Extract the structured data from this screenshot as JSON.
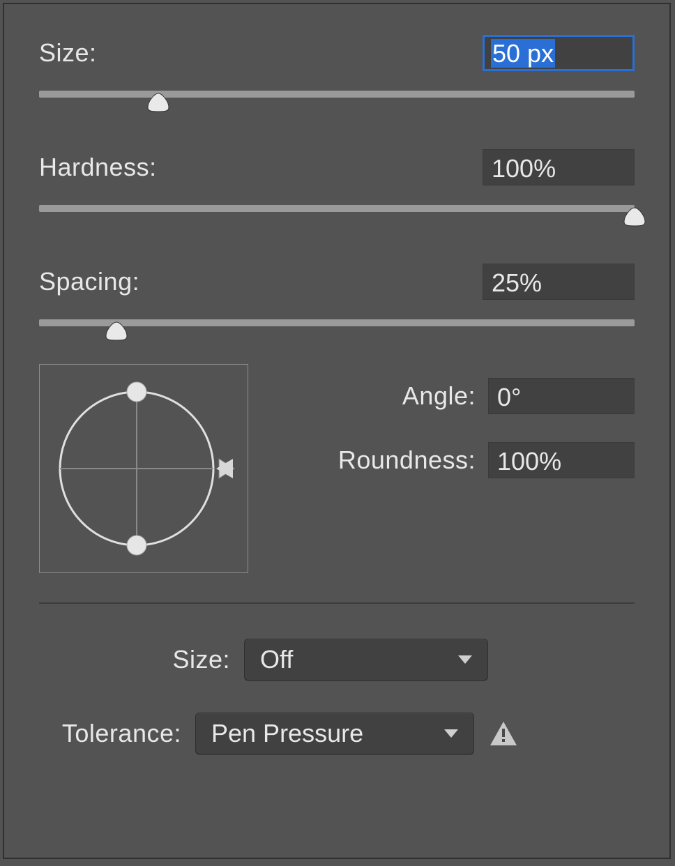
{
  "size": {
    "label": "Size:",
    "value": "50 px",
    "slider_pct": 20
  },
  "hardness": {
    "label": "Hardness:",
    "value": "100%",
    "slider_pct": 100
  },
  "spacing": {
    "label": "Spacing:",
    "value": "25%",
    "slider_pct": 13
  },
  "angle": {
    "label": "Angle:",
    "value": "0°"
  },
  "roundness": {
    "label": "Roundness:",
    "value": "100%"
  },
  "dyn_size": {
    "label": "Size:",
    "value": "Off"
  },
  "tolerance": {
    "label": "Tolerance:",
    "value": "Pen Pressure"
  }
}
